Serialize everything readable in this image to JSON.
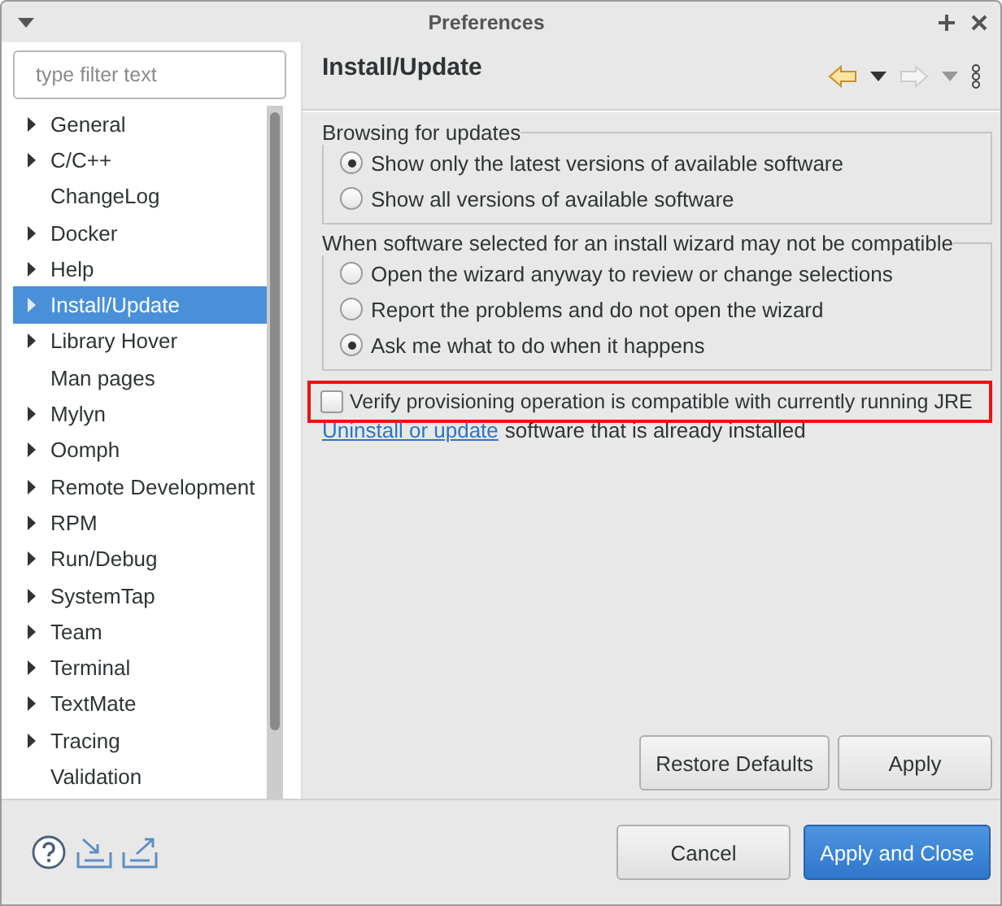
{
  "window": {
    "title": "Preferences"
  },
  "filter": {
    "placeholder": "type filter text"
  },
  "tree": [
    {
      "label": "General",
      "expandable": true,
      "selected": false
    },
    {
      "label": "C/C++",
      "expandable": true,
      "selected": false
    },
    {
      "label": "ChangeLog",
      "expandable": false,
      "selected": false
    },
    {
      "label": "Docker",
      "expandable": true,
      "selected": false
    },
    {
      "label": "Help",
      "expandable": true,
      "selected": false
    },
    {
      "label": "Install/Update",
      "expandable": true,
      "selected": true
    },
    {
      "label": "Library Hover",
      "expandable": true,
      "selected": false
    },
    {
      "label": "Man pages",
      "expandable": false,
      "selected": false
    },
    {
      "label": "Mylyn",
      "expandable": true,
      "selected": false
    },
    {
      "label": "Oomph",
      "expandable": true,
      "selected": false
    },
    {
      "label": "Remote Development",
      "expandable": true,
      "selected": false
    },
    {
      "label": "RPM",
      "expandable": true,
      "selected": false
    },
    {
      "label": "Run/Debug",
      "expandable": true,
      "selected": false
    },
    {
      "label": "SystemTap",
      "expandable": true,
      "selected": false
    },
    {
      "label": "Team",
      "expandable": true,
      "selected": false
    },
    {
      "label": "Terminal",
      "expandable": true,
      "selected": false
    },
    {
      "label": "TextMate",
      "expandable": true,
      "selected": false
    },
    {
      "label": "Tracing",
      "expandable": true,
      "selected": false
    },
    {
      "label": "Validation",
      "expandable": false,
      "selected": false
    }
  ],
  "page": {
    "title": "Install/Update",
    "groups": [
      {
        "title": "Browsing for updates",
        "options": [
          {
            "label": "Show only the latest versions of available software",
            "selected": true
          },
          {
            "label": "Show all versions of available software",
            "selected": false
          }
        ]
      },
      {
        "title": "When software selected for an install wizard may not be compatible",
        "options": [
          {
            "label": "Open the wizard anyway to review or change selections",
            "selected": false
          },
          {
            "label": "Report the problems and do not open the wizard",
            "selected": false
          },
          {
            "label": "Ask me what to do when it happens",
            "selected": true
          }
        ]
      }
    ],
    "checkbox": {
      "label": "Verify provisioning operation is compatible with currently running JRE",
      "checked": false,
      "highlighted": true
    },
    "link_line": {
      "link": "Uninstall or update",
      "text": "software that is already installed"
    },
    "buttons": [
      "Restore Defaults",
      "Apply"
    ]
  },
  "footer_buttons": [
    {
      "label": "Cancel",
      "primary": false
    },
    {
      "label": "Apply and Close",
      "primary": true
    }
  ]
}
